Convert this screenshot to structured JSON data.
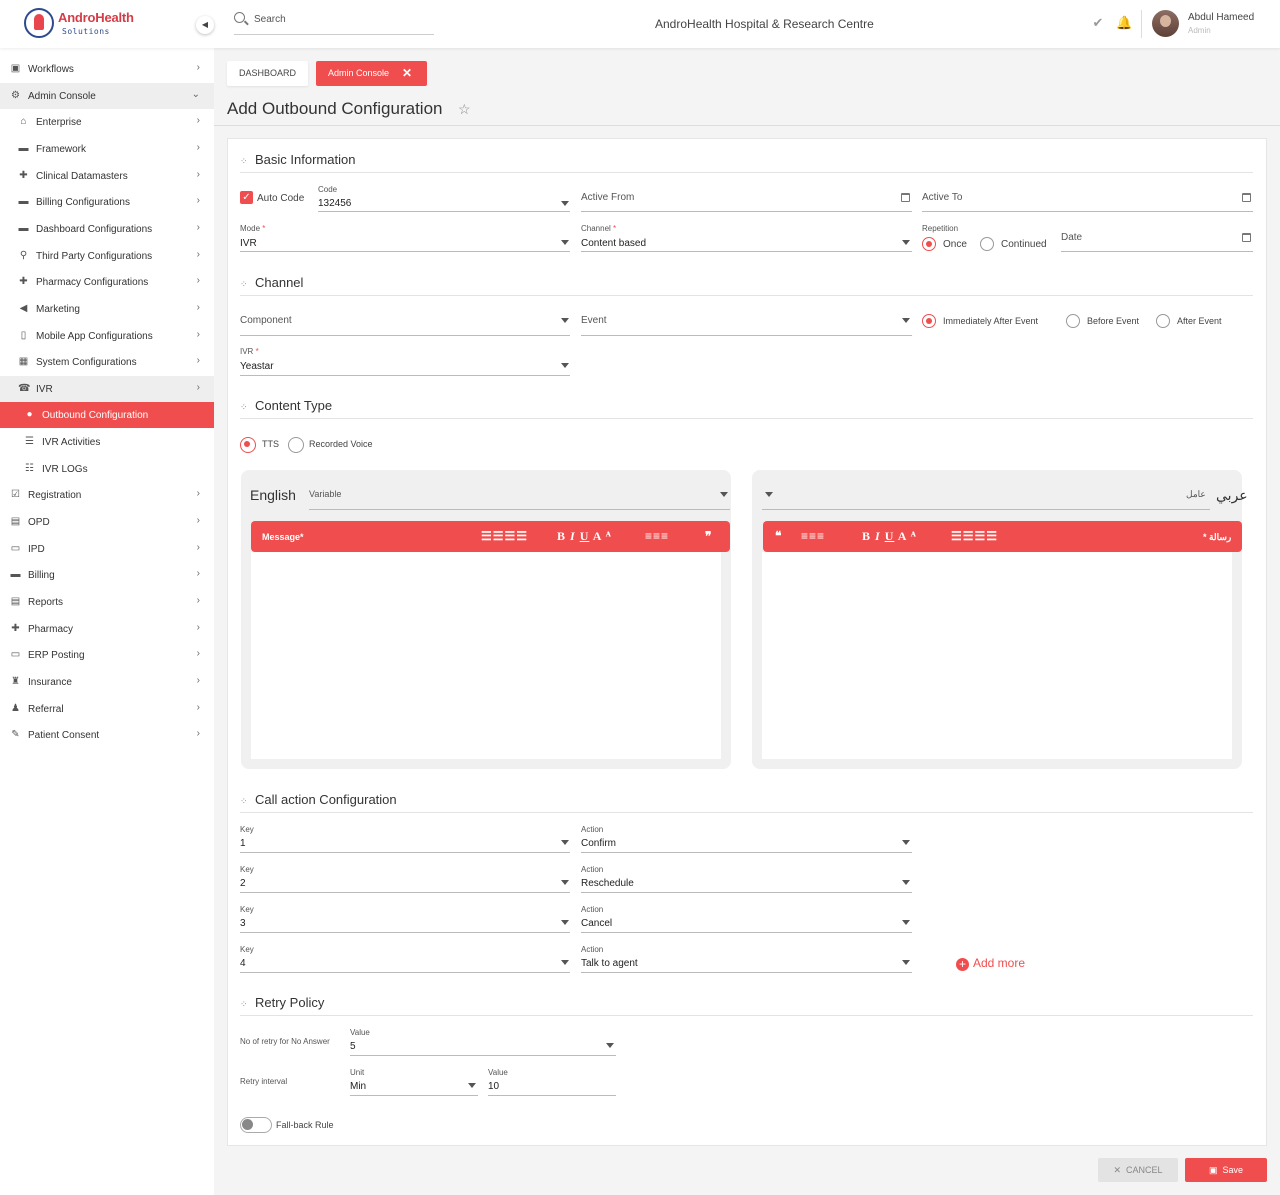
{
  "brand": {
    "name": "AndroHealth",
    "tagline": "Solutions"
  },
  "header": {
    "search_placeholder": "Search",
    "hospital": "AndroHealth Hospital & Research Centre",
    "user_name": "Abdul Hameed",
    "user_role": "Admin"
  },
  "sidebar": {
    "items": [
      {
        "label": "Workflows",
        "icon": "workflow-icon"
      },
      {
        "label": "Admin Console",
        "icon": "gear-icon"
      },
      {
        "label": "Enterprise",
        "icon": "bank-icon"
      },
      {
        "label": "Framework",
        "icon": "framework-icon"
      },
      {
        "label": "Clinical Datamasters",
        "icon": "clinical-icon"
      },
      {
        "label": "Billing Configurations",
        "icon": "billing-icon"
      },
      {
        "label": "Dashboard Configurations",
        "icon": "dashboard-icon"
      },
      {
        "label": "Third Party Configurations",
        "icon": "plug-icon"
      },
      {
        "label": "Pharmacy Configurations",
        "icon": "pharmacy-icon"
      },
      {
        "label": "Marketing",
        "icon": "megaphone-icon"
      },
      {
        "label": "Mobile App Configurations",
        "icon": "mobile-icon"
      },
      {
        "label": "System Configurations",
        "icon": "system-icon"
      },
      {
        "label": "IVR",
        "icon": "ivr-icon"
      },
      {
        "label": "Outbound Configuration",
        "icon": "outbound-icon"
      },
      {
        "label": "IVR Activities",
        "icon": "activities-icon"
      },
      {
        "label": "IVR LOGs",
        "icon": "logs-icon"
      },
      {
        "label": "Registration",
        "icon": "registration-icon"
      },
      {
        "label": "OPD",
        "icon": "opd-icon"
      },
      {
        "label": "IPD",
        "icon": "bed-icon"
      },
      {
        "label": "Billing",
        "icon": "billing-icon"
      },
      {
        "label": "Reports",
        "icon": "report-icon"
      },
      {
        "label": "Pharmacy",
        "icon": "pharmacy-icon"
      },
      {
        "label": "ERP Posting",
        "icon": "erp-icon"
      },
      {
        "label": "Insurance",
        "icon": "insurance-icon"
      },
      {
        "label": "Referral",
        "icon": "referral-icon"
      },
      {
        "label": "Patient Consent",
        "icon": "consent-icon"
      }
    ]
  },
  "tabs": {
    "dashboard": "DASHBOARD",
    "admin": "Admin Console"
  },
  "page": {
    "title": "Add Outbound Configuration"
  },
  "basic": {
    "title": "Basic Information",
    "auto_code": "Auto Code",
    "code_label": "Code",
    "code_value": "132456",
    "active_from": "Active From",
    "active_to": "Active To",
    "mode_label": "Mode",
    "mode_value": "IVR",
    "channel_label": "Channel",
    "channel_value": "Content based",
    "repetition_label": "Repetition",
    "once": "Once",
    "continued": "Continued",
    "date": "Date"
  },
  "channel": {
    "title": "Channel",
    "component": "Component",
    "event": "Event",
    "immediately": "Immediately After Event",
    "before": "Before Event",
    "after": "After Event",
    "ivr_label": "IVR",
    "ivr_value": "Yeastar"
  },
  "content": {
    "title": "Content Type",
    "tts": "TTS",
    "recorded": "Recorded Voice",
    "english": "English",
    "variable": "Variable",
    "arabic": "عربي",
    "arabic_variable": "عامل",
    "message": "Message*",
    "arabic_message": "* رسالة"
  },
  "call": {
    "title": "Call action Configuration",
    "key_label": "Key",
    "action_label": "Action",
    "rows": [
      {
        "key": "1",
        "action": "Confirm"
      },
      {
        "key": "2",
        "action": "Reschedule"
      },
      {
        "key": "3",
        "action": "Cancel"
      },
      {
        "key": "4",
        "action": "Talk to agent"
      }
    ],
    "add_more": "Add more"
  },
  "retry": {
    "title": "Retry Policy",
    "no_answer": "No of retry for No Answer",
    "value_label": "Value",
    "no_answer_value": "5",
    "interval": "Retry interval",
    "unit_label": "Unit",
    "unit_value": "Min",
    "interval_value": "10",
    "fallback": "Fall-back Rule"
  },
  "footer": {
    "cancel": "CANCEL",
    "save": "Save"
  },
  "colors": {
    "accent": "#f04e4e",
    "brand_blue": "#2e4a8f"
  }
}
